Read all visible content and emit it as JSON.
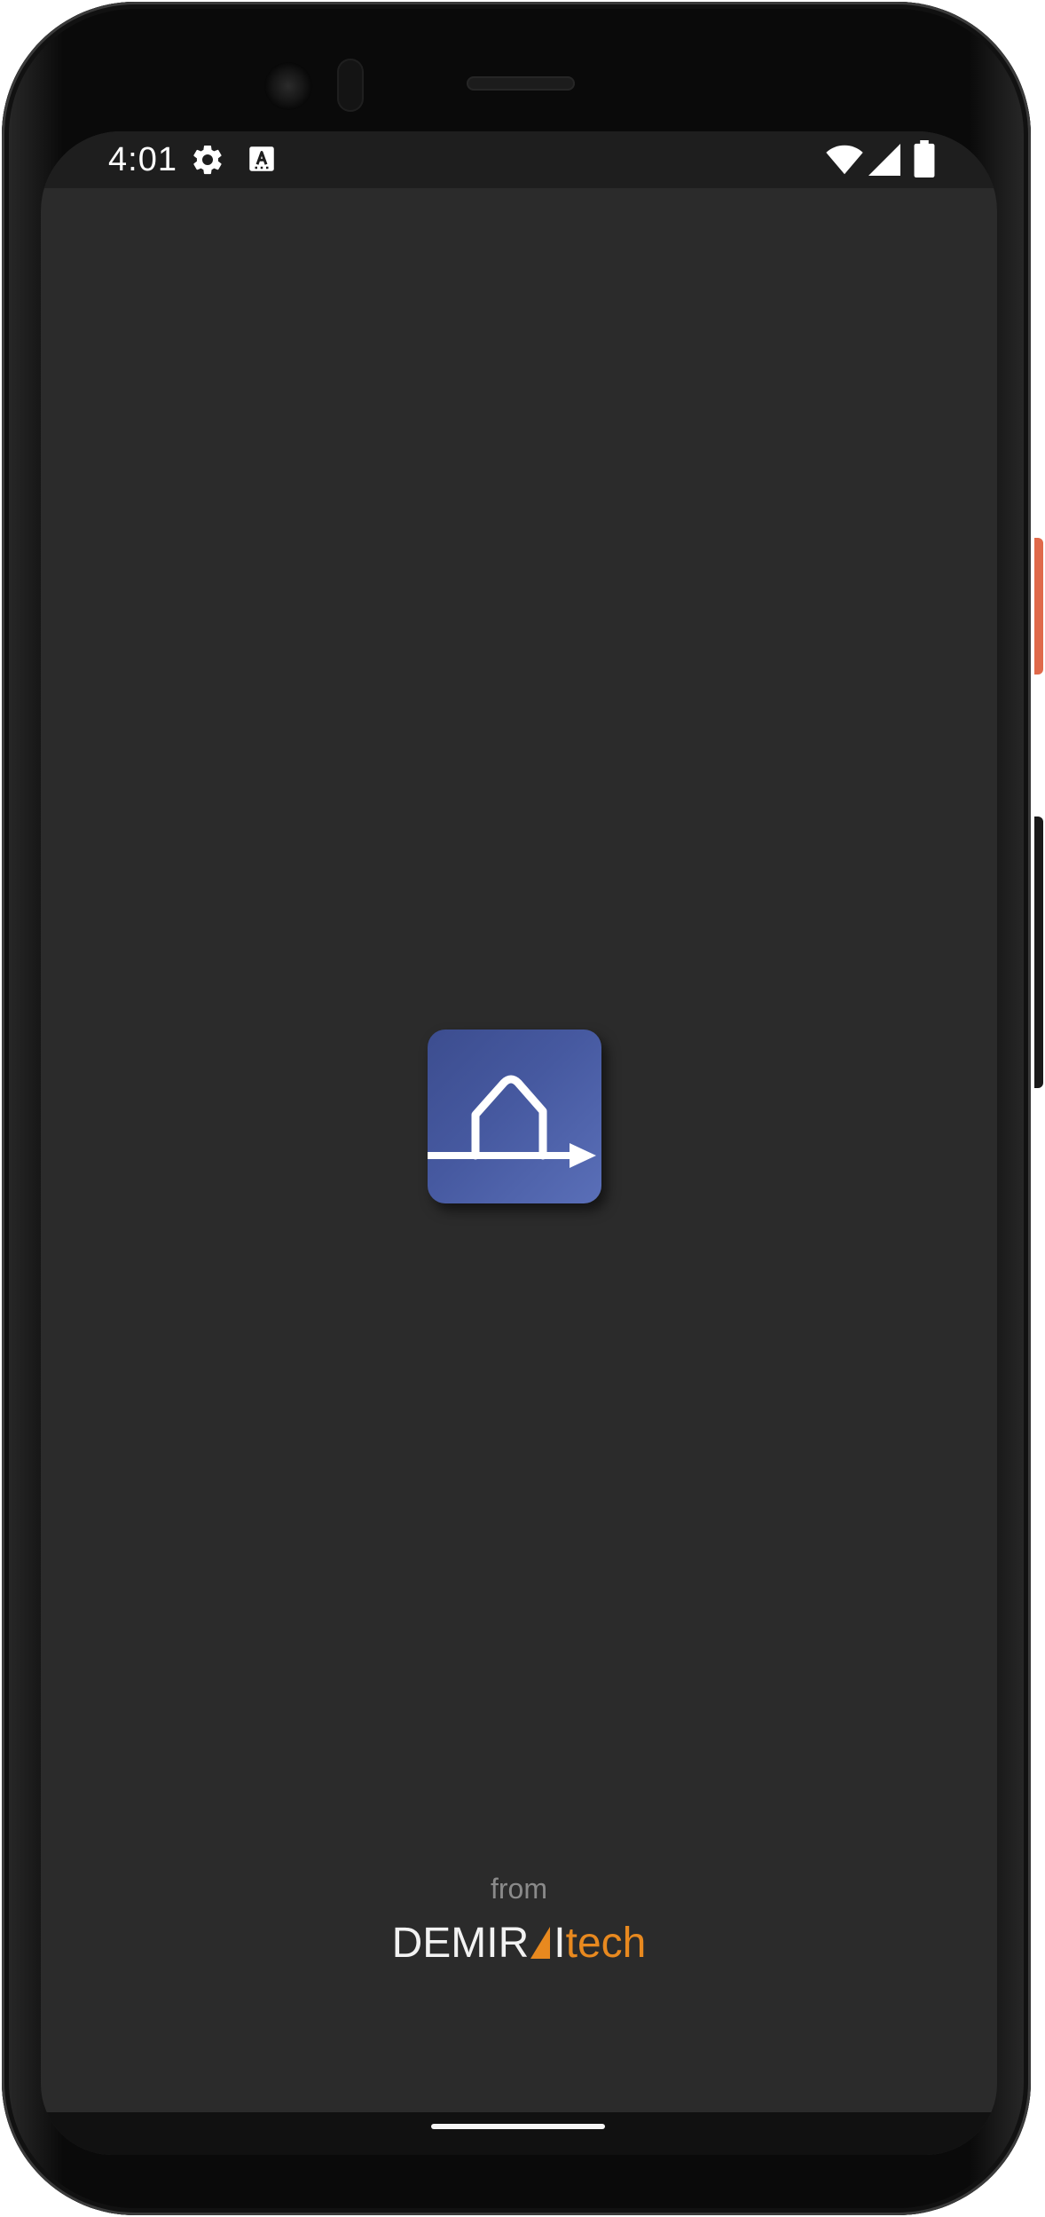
{
  "status_bar": {
    "time": "4:01",
    "left_icons": [
      "settings-gear-icon",
      "keyboard-a-icon"
    ],
    "right_icons": [
      "wifi-icon",
      "cellular-signal-icon",
      "battery-icon"
    ]
  },
  "splash": {
    "logo_icon": "house-arrow-icon",
    "logo_colors": {
      "from": "#3c4d8f",
      "to": "#5a6fb8"
    },
    "from_label": "from",
    "brand": {
      "part1": "DEMIR",
      "part2": "I",
      "part3": "tech",
      "accent_color": "#e8891f"
    }
  },
  "colors": {
    "screen_background": "#2b2b2b",
    "status_bar_background": "#1e1e1e"
  }
}
